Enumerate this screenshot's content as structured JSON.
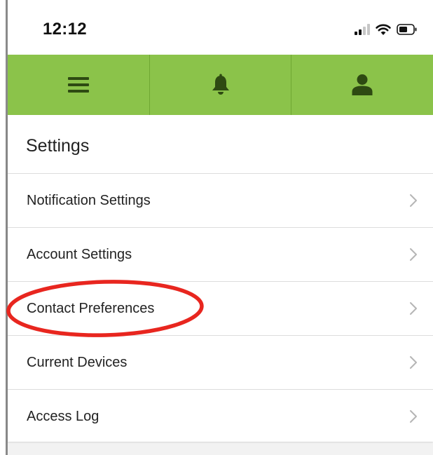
{
  "status_bar": {
    "time": "12:12",
    "icons": [
      "cellular-signal-icon",
      "wifi-icon",
      "battery-icon"
    ]
  },
  "nav_bar": {
    "accent_color": "#8bc34a",
    "icon_color": "#2e4a12",
    "buttons": [
      {
        "icon": "hamburger-menu-icon"
      },
      {
        "icon": "bell-icon"
      },
      {
        "icon": "user-icon"
      }
    ]
  },
  "settings": {
    "title": "Settings",
    "items": [
      {
        "label": "Notification Settings"
      },
      {
        "label": "Account Settings"
      },
      {
        "label": "Contact Preferences",
        "highlighted": true
      },
      {
        "label": "Current Devices"
      },
      {
        "label": "Access Log"
      }
    ]
  },
  "annotation": {
    "shape": "ellipse",
    "color": "#e8261f",
    "target": "Contact Preferences"
  }
}
